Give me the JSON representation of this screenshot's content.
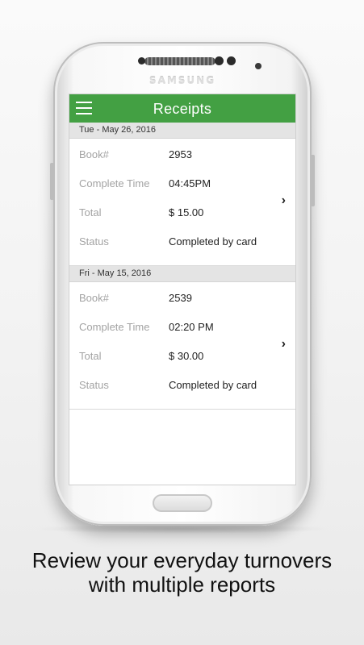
{
  "phone": {
    "brand": "SAMSUNG"
  },
  "appbar": {
    "title": "Receipts",
    "menu_icon": "hamburger-menu-icon"
  },
  "receipts": [
    {
      "date": "Tue -  May 26, 2016",
      "book_label": "Book#",
      "book": "2953",
      "time_label": "Complete Time",
      "time": "04:45PM",
      "total_label": "Total",
      "total": "$ 15.00",
      "status_label": "Status",
      "status": "Completed by card"
    },
    {
      "date": "Fri - May 15, 2016",
      "book_label": "Book#",
      "book": "2539",
      "time_label": "Complete Time",
      "time": "02:20 PM",
      "total_label": "Total",
      "total": "$ 30.00",
      "status_label": "Status",
      "status": "Completed by card"
    }
  ],
  "chevron": "›",
  "caption": {
    "line1": "Review your everyday turnovers",
    "line2": "with multiple reports"
  },
  "colors": {
    "appbar": "#43a043",
    "section_header": "#e4e4e4"
  }
}
